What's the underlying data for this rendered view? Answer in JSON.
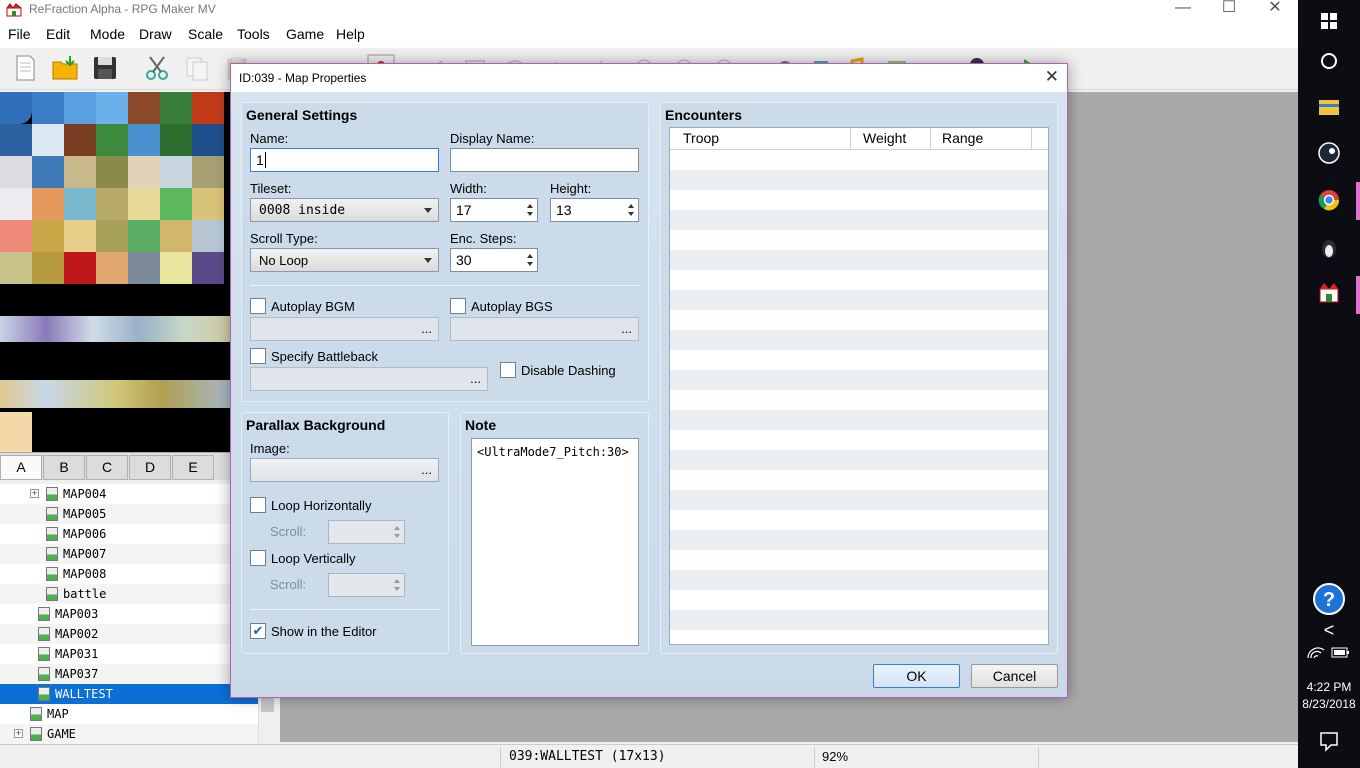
{
  "window": {
    "title": "ReFraction Alpha - RPG Maker MV",
    "minimize_glyph": "—",
    "maximize_glyph": "☐",
    "close_glyph": "✕"
  },
  "menu": [
    "File",
    "Edit",
    "Mode",
    "Draw",
    "Scale",
    "Tools",
    "Game",
    "Help"
  ],
  "tile_tabs": [
    "A",
    "B",
    "C",
    "D",
    "E"
  ],
  "map_tree": [
    {
      "label": "MAP004",
      "expander": "+"
    },
    {
      "label": "MAP005"
    },
    {
      "label": "MAP006"
    },
    {
      "label": "MAP007"
    },
    {
      "label": "MAP008"
    },
    {
      "label": "battle"
    },
    {
      "label": "MAP003"
    },
    {
      "label": "MAP002"
    },
    {
      "label": "MAP031"
    },
    {
      "label": "MAP037"
    },
    {
      "label": "WALLTEST",
      "selected": true
    },
    {
      "label": "MAP"
    },
    {
      "label": "GAME",
      "expander": "+"
    }
  ],
  "status": {
    "map": "039:WALLTEST (17x13)",
    "zoom": "92%"
  },
  "taskbar": {
    "time": "4:22 PM",
    "date": "8/23/2018",
    "help_glyph": "?",
    "back_glyph": "<"
  },
  "dialog": {
    "title": "ID:039 - Map Properties",
    "close_glyph": "✕",
    "general": {
      "title": "General Settings",
      "name_label": "Name:",
      "name_value": "1",
      "display_name_label": "Display Name:",
      "display_name_value": "",
      "tileset_label": "Tileset:",
      "tileset_value": "0008 inside",
      "width_label": "Width:",
      "width_value": "17",
      "height_label": "Height:",
      "height_value": "13",
      "scroll_type_label": "Scroll Type:",
      "scroll_type_value": "No Loop",
      "enc_steps_label": "Enc. Steps:",
      "enc_steps_value": "30",
      "autoplay_bgm_label": "Autoplay BGM",
      "autoplay_bgs_label": "Autoplay BGS",
      "specify_battleback_label": "Specify Battleback",
      "disable_dashing_label": "Disable Dashing",
      "browse_glyph": "..."
    },
    "parallax": {
      "title": "Parallax Background",
      "image_label": "Image:",
      "loop_h_label": "Loop Horizontally",
      "loop_v_label": "Loop Vertically",
      "scroll_label": "Scroll:",
      "show_editor_label": "Show in the Editor",
      "show_editor_checked": true,
      "check_glyph": "✔"
    },
    "note": {
      "title": "Note",
      "text": "<UltraMode7_Pitch:30>"
    },
    "encounters": {
      "title": "Encounters",
      "columns": [
        "Troop",
        "Weight",
        "Range"
      ]
    },
    "ok_label": "OK",
    "cancel_label": "Cancel"
  }
}
